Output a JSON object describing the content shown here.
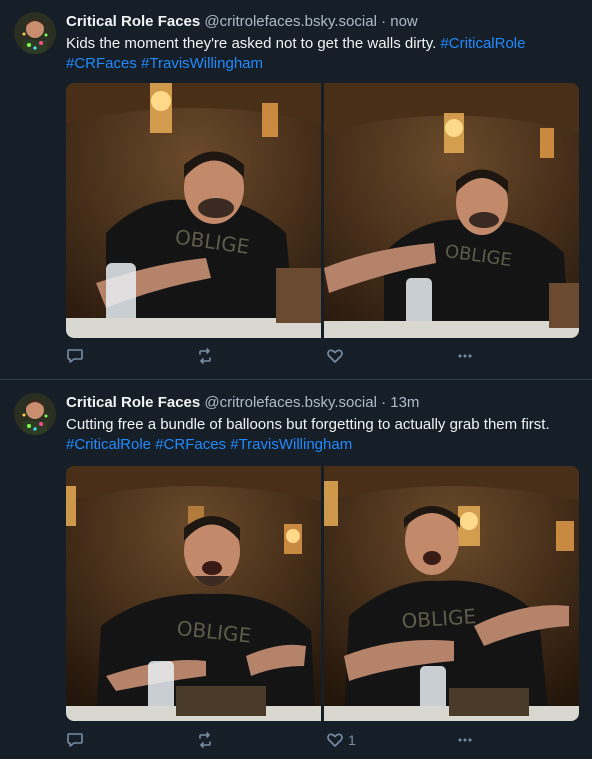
{
  "posts": [
    {
      "author": "Critical Role Faces",
      "handle": "@critrolefaces.bsky.social",
      "time": "now",
      "text": "Kids the moment they're asked not to get the walls dirty. ",
      "hashtags": [
        "#CriticalRole",
        "#CRFaces",
        "#TravisWillingham"
      ],
      "like_count": "",
      "images": [
        "man in black OBLIGE t-shirt blowing cheeks, hand raised",
        "man in black OBLIGE t-shirt blowing cheeks, arm extended"
      ]
    },
    {
      "author": "Critical Role Faces",
      "handle": "@critrolefaces.bsky.social",
      "time": "13m",
      "text": "Cutting free a bundle of balloons but forgetting to actually grab them first. ",
      "hashtags": [
        "#CriticalRole",
        "#CRFaces",
        "#TravisWillingham"
      ],
      "like_count": "1",
      "images": [
        "man in black OBLIGE t-shirt looking surprised, hands together",
        "man in black OBLIGE t-shirt looking up surprised, hands apart"
      ]
    }
  ],
  "separator": " · ",
  "icons": {
    "reply": "speech-bubble-icon",
    "repost": "repost-arrows-icon",
    "like": "heart-icon",
    "more": "ellipsis-icon"
  },
  "colors": {
    "background": "#161e27",
    "link": "#208bfe",
    "muted": "#aebbc9",
    "action": "#788ea5",
    "divider": "#2e3f51"
  }
}
